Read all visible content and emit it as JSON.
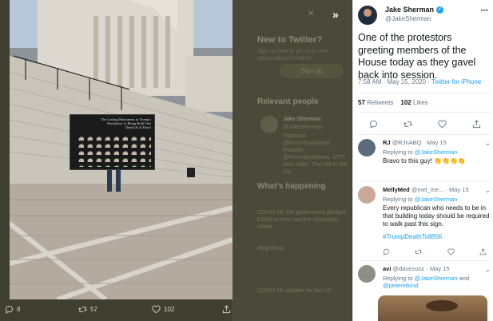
{
  "background": {
    "new_to_twitter_title": "New to Twitter?",
    "new_to_twitter_sub": "Sign up now to get your own personalized timeline!",
    "signup_label": "Sign up",
    "relevant_people_title": "Relevant people",
    "relevant_person_name": "Jake Sherman",
    "relevant_person_handle": "@JakeSherman",
    "relevant_person_bio": "Playbook. @PunchbowlNews. Founder @PunchbowlNews. NYT best seller. 'The Hill to Die On.'",
    "whats_happening_title": "What’s happening",
    "trend_1": "COVID-19: UK government pledges £30bn to new vaccine innovation center",
    "trend_2": "#Rightnow",
    "trend_3": "COVID-19 updates for the US"
  },
  "photo": {
    "sign_text": "The Lasting Monument to Trump's Presidency Is Being Built One Death At A Time!",
    "actions": {
      "replies": "8",
      "retweets": "57",
      "likes": "102"
    }
  },
  "tweet": {
    "name": "Jake Sherman",
    "handle": "@JakeSherman",
    "text": "One of the protestors greeting members of the House today as they gavel back into session.",
    "time": "7:58 AM · May 15, 2020",
    "source": "Twitter for iPhone",
    "retweets_count": "57",
    "retweets_label": "Retweets",
    "likes_count": "102",
    "likes_label": "Likes"
  },
  "replies": [
    {
      "name": "RJ",
      "handle": "@RJnABQ",
      "date": "May 15",
      "replying_to": "@JakeSherman",
      "text": "Bravo to this guy! 👏👏👏👏"
    },
    {
      "name": "MellyMed",
      "handle": "@mel_me...",
      "date": "May 15",
      "replying_to": "@JakeSherman",
      "text": "Every republican who needs to be in that building today should be required to walk past this sign.",
      "hashtag": "#TrumpDeathToll85K"
    },
    {
      "name": "avi",
      "handle": "@davezooz",
      "date": "May 15",
      "replying_to": "@JakeSherman",
      "replying_and": "and",
      "replying_to_2": "@peterelkind"
    }
  ],
  "colors": {
    "accent": "#1da1f2",
    "overlay": "#3f3f32",
    "text_primary": "#14171a",
    "text_secondary": "#657786"
  },
  "icons": [
    "reply-icon",
    "retweet-icon",
    "like-icon",
    "share-icon",
    "expand-icon",
    "more-icon",
    "verified-icon"
  ]
}
